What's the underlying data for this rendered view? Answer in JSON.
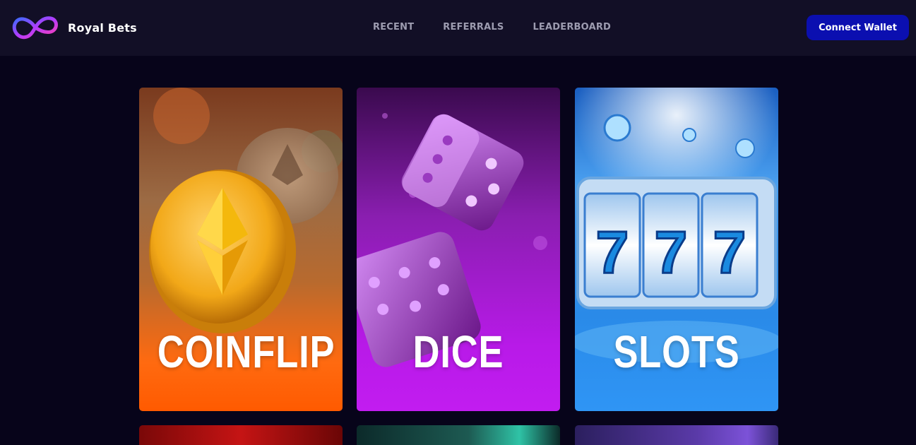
{
  "brand": {
    "name": "Royal Bets",
    "logo": "infinity-logo"
  },
  "nav": {
    "items": [
      "RECENT",
      "REFERRALS",
      "LEADERBOARD"
    ]
  },
  "header": {
    "connect_label": "Connect Wallet"
  },
  "colors": {
    "background": "#07041a",
    "topbar": "#120f26",
    "accent_button": "#0b0fb0",
    "nav_text": "#9d9cb0"
  },
  "games": [
    {
      "title": "COINFLIP",
      "theme": "ethereum-coin"
    },
    {
      "title": "DICE",
      "theme": "purple-dice"
    },
    {
      "title": "SLOTS",
      "theme": "slot-machine-777"
    }
  ]
}
